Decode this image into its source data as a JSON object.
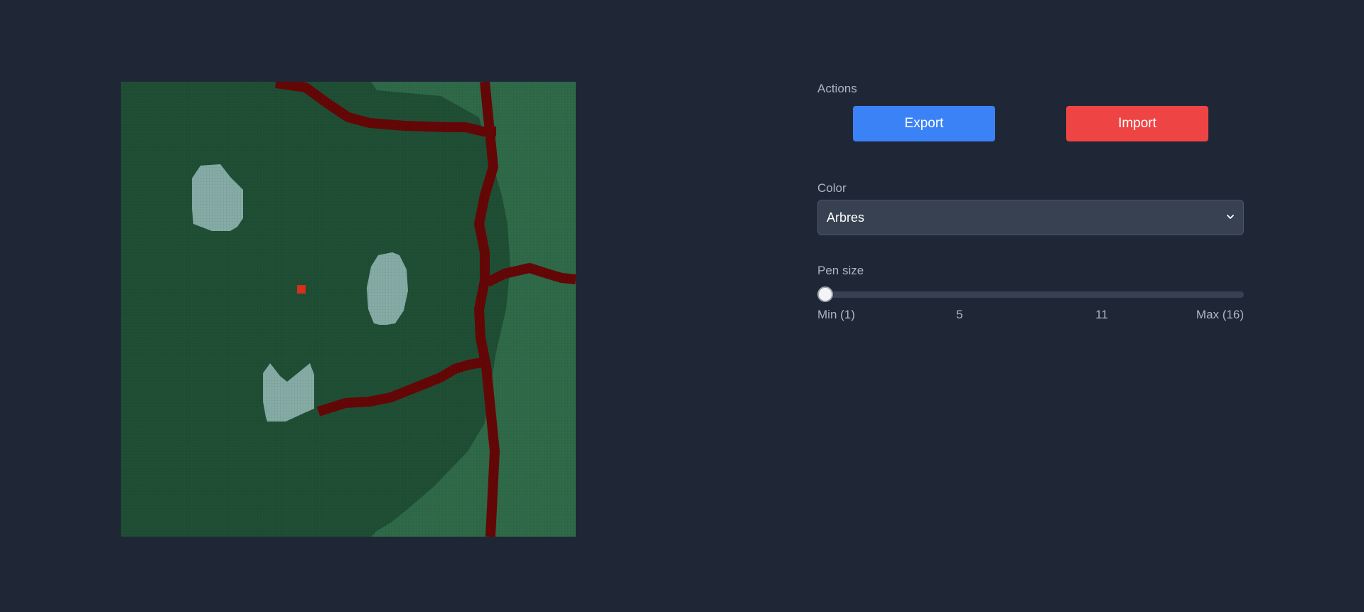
{
  "canvas": {
    "colors": {
      "forest": "#1f4f35",
      "grass": "#2f6a49",
      "river": "#650707",
      "rock": "#86aca6",
      "cursor": "#d62f1b"
    }
  },
  "actions": {
    "label": "Actions",
    "export_label": "Export",
    "import_label": "Import"
  },
  "color": {
    "label": "Color",
    "selected": "Arbres"
  },
  "pen_size": {
    "label": "Pen size",
    "value": 1,
    "min": 1,
    "max": 16,
    "ticks": {
      "min": "Min (1)",
      "t5": "5",
      "t11": "11",
      "max": "Max (16)"
    }
  }
}
